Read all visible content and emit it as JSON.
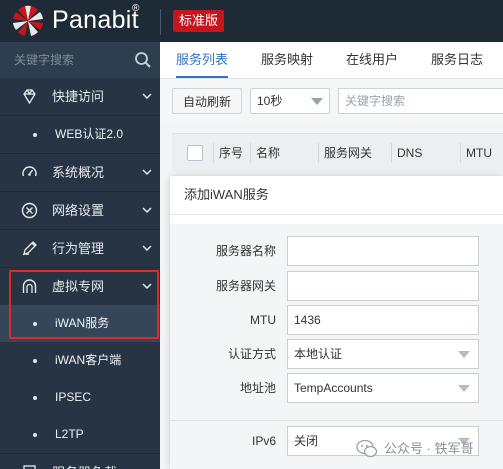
{
  "header": {
    "brand": "Panabit",
    "registered_mark": "®",
    "edition_badge": "标准版"
  },
  "colors": {
    "header_bg": "#1e2a36",
    "sidebar_bg": "#263443",
    "accent": "#2f74c0",
    "badge": "#c4161c",
    "highlight": "#e02a2a"
  },
  "sidebar": {
    "search_placeholder": "关键字搜索",
    "items": [
      {
        "label": "快捷访问",
        "icon": "diamond-icon"
      },
      {
        "label": "WEB认证2.0",
        "sub": true
      },
      {
        "label": "系统概况",
        "icon": "gauge-icon"
      },
      {
        "label": "网络设置",
        "icon": "circle-x-icon"
      },
      {
        "label": "行为管理",
        "icon": "pen-icon"
      },
      {
        "label": "虚拟专网",
        "icon": "tunnel-icon",
        "highlighted": true
      },
      {
        "label": "iWAN服务",
        "sub": true,
        "active": true,
        "highlighted": true
      },
      {
        "label": "iWAN客户端",
        "sub": true
      },
      {
        "label": "IPSEC",
        "sub": true
      },
      {
        "label": "L2TP",
        "sub": true
      },
      {
        "label": "服务器负载",
        "icon": "server-icon"
      }
    ]
  },
  "tabs": [
    {
      "label": "服务列表",
      "active": true
    },
    {
      "label": "服务映射"
    },
    {
      "label": "在线用户"
    },
    {
      "label": "服务日志"
    }
  ],
  "toolbar": {
    "refresh_label": "自动刷新",
    "interval_value": "10秒",
    "keyword_placeholder": "关键字搜索"
  },
  "table": {
    "columns": [
      "序号",
      "名称",
      "服务网关",
      "DNS",
      "MTU"
    ]
  },
  "modal": {
    "title": "添加iWAN服务",
    "fields": [
      {
        "label": "服务器名称",
        "value": ""
      },
      {
        "label": "服务器网关",
        "value": ""
      },
      {
        "label": "MTU",
        "value": "1436"
      },
      {
        "label": "认证方式",
        "value": "本地认证",
        "select": true
      },
      {
        "label": "地址池",
        "value": "TempAccounts",
        "select": true
      },
      {
        "label": "IPv6",
        "value": "关闭",
        "select": true
      }
    ]
  },
  "watermark": {
    "text": "公众号 · 铁军哥",
    "icon": "wechat-icon"
  }
}
